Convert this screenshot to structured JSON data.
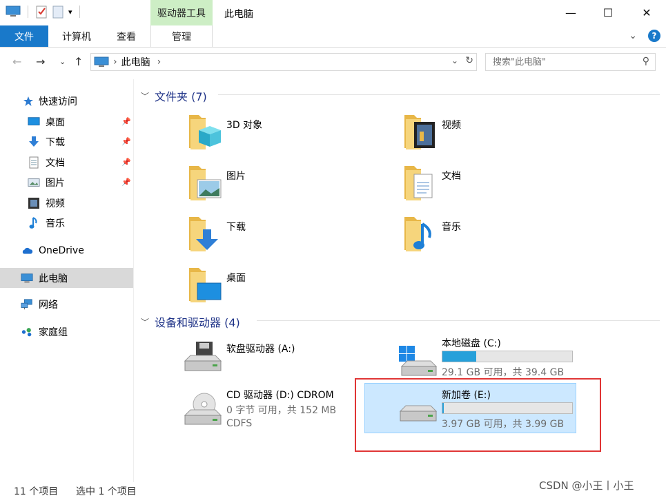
{
  "titlebar": {
    "context_tab": "驱动器工具",
    "title": "此电脑",
    "minimize": "—",
    "maximize": "☐",
    "close": "✕"
  },
  "ribbon": {
    "tabs": [
      "文件",
      "计算机",
      "查看",
      "管理"
    ],
    "expand": "⌄",
    "help": "?"
  },
  "address": {
    "back": "←",
    "forward": "→",
    "recent": "⌄",
    "up": "↑",
    "path": "此电脑",
    "separator": "›",
    "search_placeholder": "搜索\"此电脑\""
  },
  "sidebar": {
    "items": [
      {
        "label": "快速访问",
        "icon": "star-icon"
      },
      {
        "label": "桌面",
        "icon": "desktop-icon",
        "pinned": true
      },
      {
        "label": "下载",
        "icon": "download-icon",
        "pinned": true
      },
      {
        "label": "文档",
        "icon": "document-icon",
        "pinned": true
      },
      {
        "label": "图片",
        "icon": "picture-icon",
        "pinned": true
      },
      {
        "label": "视频",
        "icon": "video-icon"
      },
      {
        "label": "音乐",
        "icon": "music-icon"
      },
      {
        "label": "OneDrive",
        "icon": "cloud-icon"
      },
      {
        "label": "此电脑",
        "icon": "computer-icon",
        "selected": true
      },
      {
        "label": "网络",
        "icon": "network-icon"
      },
      {
        "label": "家庭组",
        "icon": "homegroup-icon"
      }
    ]
  },
  "folders": {
    "header": "文件夹 (7)",
    "items": [
      {
        "label": "3D 对象",
        "icon": "3d-objects-folder-icon"
      },
      {
        "label": "视频",
        "icon": "videos-folder-icon"
      },
      {
        "label": "图片",
        "icon": "pictures-folder-icon"
      },
      {
        "label": "文档",
        "icon": "documents-folder-icon"
      },
      {
        "label": "下载",
        "icon": "downloads-folder-icon"
      },
      {
        "label": "音乐",
        "icon": "music-folder-icon"
      },
      {
        "label": "桌面",
        "icon": "desktop-folder-icon"
      }
    ]
  },
  "devices": {
    "header": "设备和驱动器 (4)",
    "items": [
      {
        "name": "软盘驱动器 (A:)",
        "icon": "floppy-drive-icon"
      },
      {
        "name": "本地磁盘 (C:)",
        "icon": "windows-drive-icon",
        "usage": "29.1 GB 可用，共 39.4 GB",
        "used_fraction": 0.26
      },
      {
        "name": "CD 驱动器 (D:) CDROM",
        "icon": "cd-drive-icon",
        "line2": "0 字节 可用，共 152 MB",
        "line3": "CDFS"
      },
      {
        "name": "新加卷 (E:)",
        "icon": "hard-drive-icon",
        "usage": "3.97 GB 可用，共 3.99 GB",
        "used_fraction": 0.01,
        "selected": true
      }
    ]
  },
  "status": {
    "count": "11 个项目",
    "selection": "选中 1 个项目"
  },
  "watermark": "CSDN @小王丨小王",
  "colors": {
    "accent": "#1979ca",
    "context_tab": "#cdeec5",
    "selection": "#cce8ff",
    "bar_fill": "#26a0da",
    "highlight_box": "#e03535"
  }
}
